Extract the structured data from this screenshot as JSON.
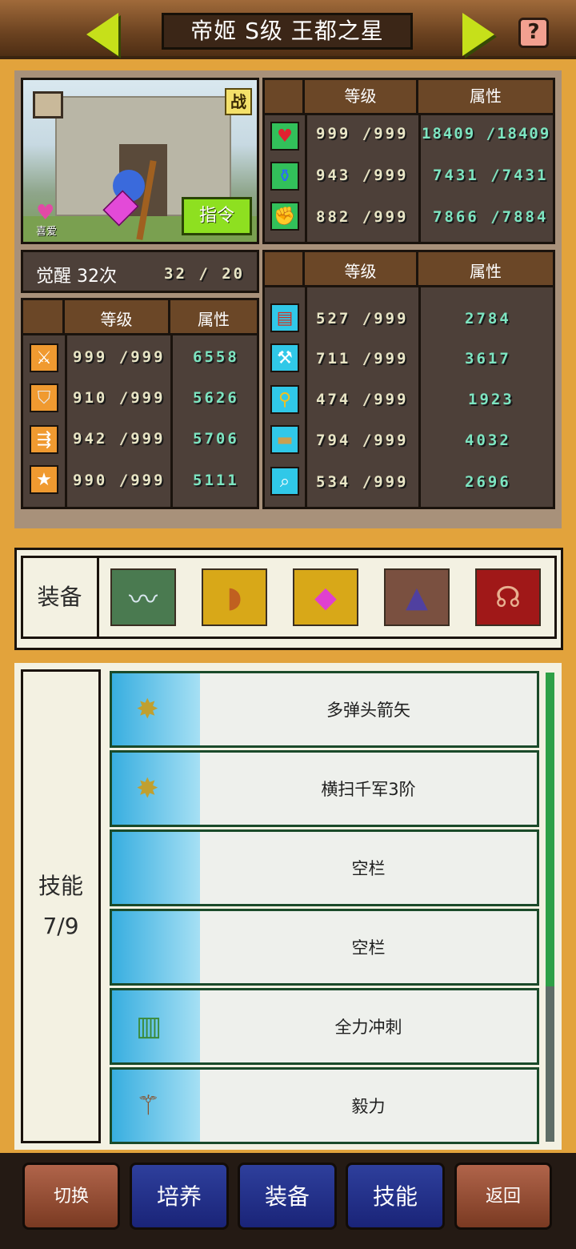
{
  "header": {
    "title": "帝姬 S级 王都之星",
    "prev_icon": "arrow-left-icon",
    "next_icon": "arrow-right-icon",
    "help_label": "?"
  },
  "portrait": {
    "battle_badge": "战",
    "favorite_label": "喜爱",
    "command_label": "指令"
  },
  "stats": {
    "col_level": "等级",
    "col_attr": "属性",
    "top": [
      {
        "icon": "heart-icon",
        "level": "999 /999",
        "attr": "18409 /18409"
      },
      {
        "icon": "potion-icon",
        "level": "943 /999",
        "attr": "7431 /7431"
      },
      {
        "icon": "muscle-icon",
        "level": "882 /999",
        "attr": "7866 /7884"
      }
    ],
    "awaken": {
      "label": "觉醒 32次",
      "value": "32 / 20"
    },
    "left": [
      {
        "icon": "sword-icon",
        "level": "999 /999",
        "attr": "6558"
      },
      {
        "icon": "shield-icon",
        "level": "910 /999",
        "attr": "5626"
      },
      {
        "icon": "arrows-icon",
        "level": "942 /999",
        "attr": "5706"
      },
      {
        "icon": "star-icon",
        "level": "990 /999",
        "attr": "5111"
      }
    ],
    "right": [
      {
        "icon": "book-icon",
        "level": "527 /999",
        "attr": "2784"
      },
      {
        "icon": "pickaxe-icon",
        "level": "711 /999",
        "attr": "3617"
      },
      {
        "icon": "shovel-icon",
        "level": "474 /999",
        "attr": "1923"
      },
      {
        "icon": "chest-icon",
        "level": "794 /999",
        "attr": "4032"
      },
      {
        "icon": "scope-icon",
        "level": "534 /999",
        "attr": "2696"
      }
    ]
  },
  "equipment": {
    "label": "装备",
    "items": [
      "wings-icon",
      "bow-icon",
      "gem-icon",
      "cloak-icon",
      "necklace-icon"
    ]
  },
  "skills": {
    "label": "技能",
    "count": "7/9",
    "items": [
      {
        "icon": "sword-sparkle-icon",
        "name": "多弹头箭矢"
      },
      {
        "icon": "sword-sparkle-icon",
        "name": "横扫千军3阶"
      },
      {
        "icon": "",
        "name": "空栏"
      },
      {
        "icon": "",
        "name": "空栏"
      },
      {
        "icon": "scroll-icon",
        "name": "全力冲刺"
      },
      {
        "icon": "wand-icon",
        "name": "毅力"
      }
    ]
  },
  "bottom": {
    "switch": "切换",
    "train": "培养",
    "equip": "装备",
    "skills": "技能",
    "back": "返回"
  }
}
